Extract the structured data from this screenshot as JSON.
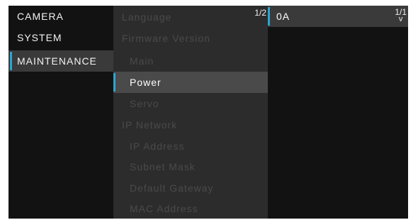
{
  "menu": {
    "items": [
      {
        "label": "CAMERA"
      },
      {
        "label": "SYSTEM"
      },
      {
        "label": "MAINTENANCE"
      }
    ]
  },
  "submenu": {
    "page": "1/2",
    "items": [
      {
        "label": "Language"
      },
      {
        "label": "Firmware Version"
      },
      {
        "label": "Main"
      },
      {
        "label": "Power"
      },
      {
        "label": "Servo"
      },
      {
        "label": "IP Network"
      },
      {
        "label": "IP Address"
      },
      {
        "label": "Subnet Mask"
      },
      {
        "label": "Default Gateway"
      },
      {
        "label": "MAC Address"
      }
    ]
  },
  "value_panel": {
    "value": "0A",
    "page": "1/1",
    "arrow": "v"
  },
  "colors": {
    "accent": "#2aa6d0",
    "screen_bg": "#161616",
    "list_bg": "#2c2c2c"
  }
}
